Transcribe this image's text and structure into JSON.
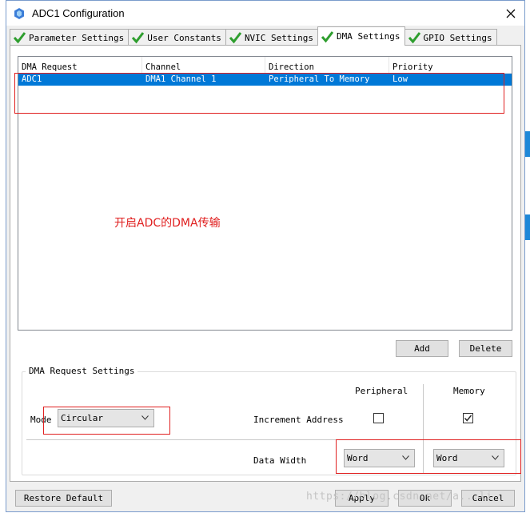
{
  "window": {
    "title": "ADC1 Configuration"
  },
  "tabs": [
    {
      "label": "Parameter Settings",
      "active": false
    },
    {
      "label": "User Constants",
      "active": false
    },
    {
      "label": "NVIC Settings",
      "active": false
    },
    {
      "label": "DMA Settings",
      "active": true
    },
    {
      "label": "GPIO Settings",
      "active": false
    }
  ],
  "table": {
    "columns": [
      "DMA Request",
      "Channel",
      "Direction",
      "Priority"
    ],
    "rows": [
      {
        "request": "ADC1",
        "channel": "DMA1 Channel 1",
        "direction": "Peripheral To Memory",
        "priority": "Low",
        "selected": true
      }
    ]
  },
  "annotation": {
    "text": "开启ADC的DMA传输",
    "color": "#e02020"
  },
  "actions": {
    "add": "Add",
    "delete": "Delete"
  },
  "settings": {
    "group_title": "DMA Request Settings",
    "peripheral_header": "Peripheral",
    "memory_header": "Memory",
    "mode_label": "Mode",
    "mode_value": "Circular",
    "increment_label": "Increment Address",
    "peripheral_increment": false,
    "memory_increment": true,
    "data_width_label": "Data Width",
    "peripheral_width": "Word",
    "memory_width": "Word"
  },
  "footer": {
    "restore": "Restore Default",
    "apply": "Apply",
    "ok": "Ok",
    "cancel": "Cancel"
  },
  "watermark": "https://blog.csdn.net/a...li",
  "colors": {
    "selection": "#0078d7",
    "accent_check": "#2e9e2e",
    "annotation": "#e02020"
  }
}
